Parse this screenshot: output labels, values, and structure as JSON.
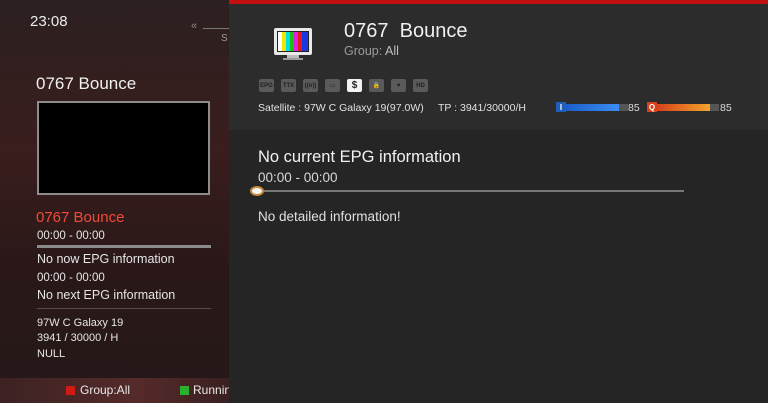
{
  "clock": "23:08",
  "background_panel": {
    "nav_arrow": "«",
    "partial_letter": "S",
    "channel_title": "0767 Bounce",
    "current_event": "0767 Bounce",
    "current_time": "00:00 - 00:00",
    "now_info": "No now EPG information",
    "next_time": "00:00 - 00:00",
    "next_info": "No next EPG information",
    "satellite": "97W C Galaxy 19",
    "transponder": "3941 / 30000 / H",
    "extra": "NULL"
  },
  "bottom_bar": {
    "red_label": "Group:All",
    "green_label": "Running",
    "red_color": "#d01b12",
    "green_color": "#27b12c"
  },
  "info_panel": {
    "channel_name": "0767  Bounce",
    "group_prefix": "Group:",
    "group_value": "All",
    "tv_icon": "tv-icon",
    "service_icons": [
      {
        "name": "epg-icon",
        "text": "EPG",
        "active": false
      },
      {
        "name": "teletext-icon",
        "text": "TTX",
        "active": false
      },
      {
        "name": "radio-icon",
        "text": "((o))",
        "active": false
      },
      {
        "name": "subtitle-icon",
        "text": "▭",
        "active": false
      },
      {
        "name": "scrambled-dollar-icon",
        "text": "$",
        "active": true
      },
      {
        "name": "lock-icon",
        "text": "🔒",
        "active": false
      },
      {
        "name": "favorite-heart-icon",
        "text": "♥",
        "active": false
      },
      {
        "name": "hd-icon",
        "text": "HD",
        "active": false
      }
    ],
    "satellite_line": "Satellite : 97W C Galaxy 19(97.0W)",
    "tp_line": "TP : 3941/30000/H",
    "intensity_label": "I",
    "intensity_value": "85",
    "intensity_level": 0.85,
    "quality_label": "Q",
    "quality_value": "85",
    "quality_level": 0.85,
    "epg_title": "No current EPG information",
    "epg_time": "00:00 - 00:00",
    "epg_progress": 0,
    "epg_detail": "No detailed information!"
  },
  "colors": {
    "accent_red": "#c01010",
    "highlight_red_text": "#f04a3a",
    "intensity_blue": "#1e5db8",
    "quality_orange": "#d8401b"
  }
}
